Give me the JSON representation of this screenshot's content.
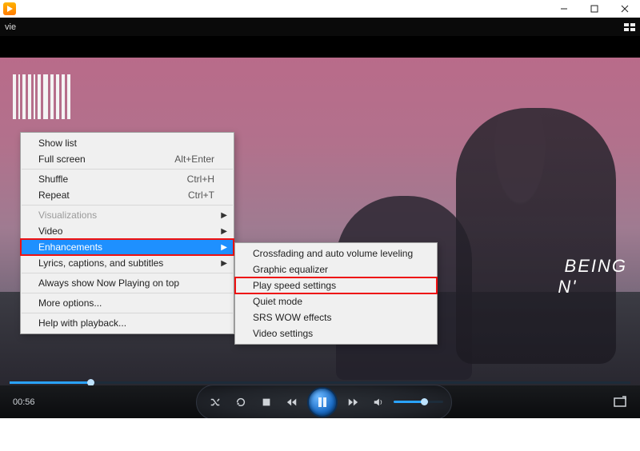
{
  "header": {
    "tab_label": "vie"
  },
  "video": {
    "lyric_text": " BEING\nN'",
    "elapsed": "00:56",
    "progress_pct": 13,
    "volume_pct": 62
  },
  "menu": {
    "items": [
      {
        "label": "Show list",
        "accel": "",
        "arrow": false
      },
      {
        "label": "Full screen",
        "accel": "Alt+Enter",
        "arrow": false
      },
      {
        "sep": true
      },
      {
        "label": "Shuffle",
        "accel": "Ctrl+H",
        "arrow": false
      },
      {
        "label": "Repeat",
        "accel": "Ctrl+T",
        "arrow": false
      },
      {
        "sep": true
      },
      {
        "label": "Visualizations",
        "accel": "",
        "arrow": true,
        "disabled": true
      },
      {
        "label": "Video",
        "accel": "",
        "arrow": true
      },
      {
        "label": "Enhancements",
        "accel": "",
        "arrow": true,
        "hover": true,
        "redbox": true
      },
      {
        "label": "Lyrics, captions, and subtitles",
        "accel": "",
        "arrow": true
      },
      {
        "sep": true
      },
      {
        "label": "Always show Now Playing on top",
        "accel": "",
        "arrow": false
      },
      {
        "sep": true
      },
      {
        "label": "More options...",
        "accel": "",
        "arrow": false
      },
      {
        "sep": true
      },
      {
        "label": "Help with playback...",
        "accel": "",
        "arrow": false
      }
    ]
  },
  "submenu": {
    "items": [
      {
        "label": "Crossfading and auto volume leveling"
      },
      {
        "label": "Graphic equalizer"
      },
      {
        "label": "Play speed settings",
        "redbox": true
      },
      {
        "label": "Quiet mode"
      },
      {
        "label": "SRS WOW effects"
      },
      {
        "label": "Video settings"
      }
    ]
  }
}
